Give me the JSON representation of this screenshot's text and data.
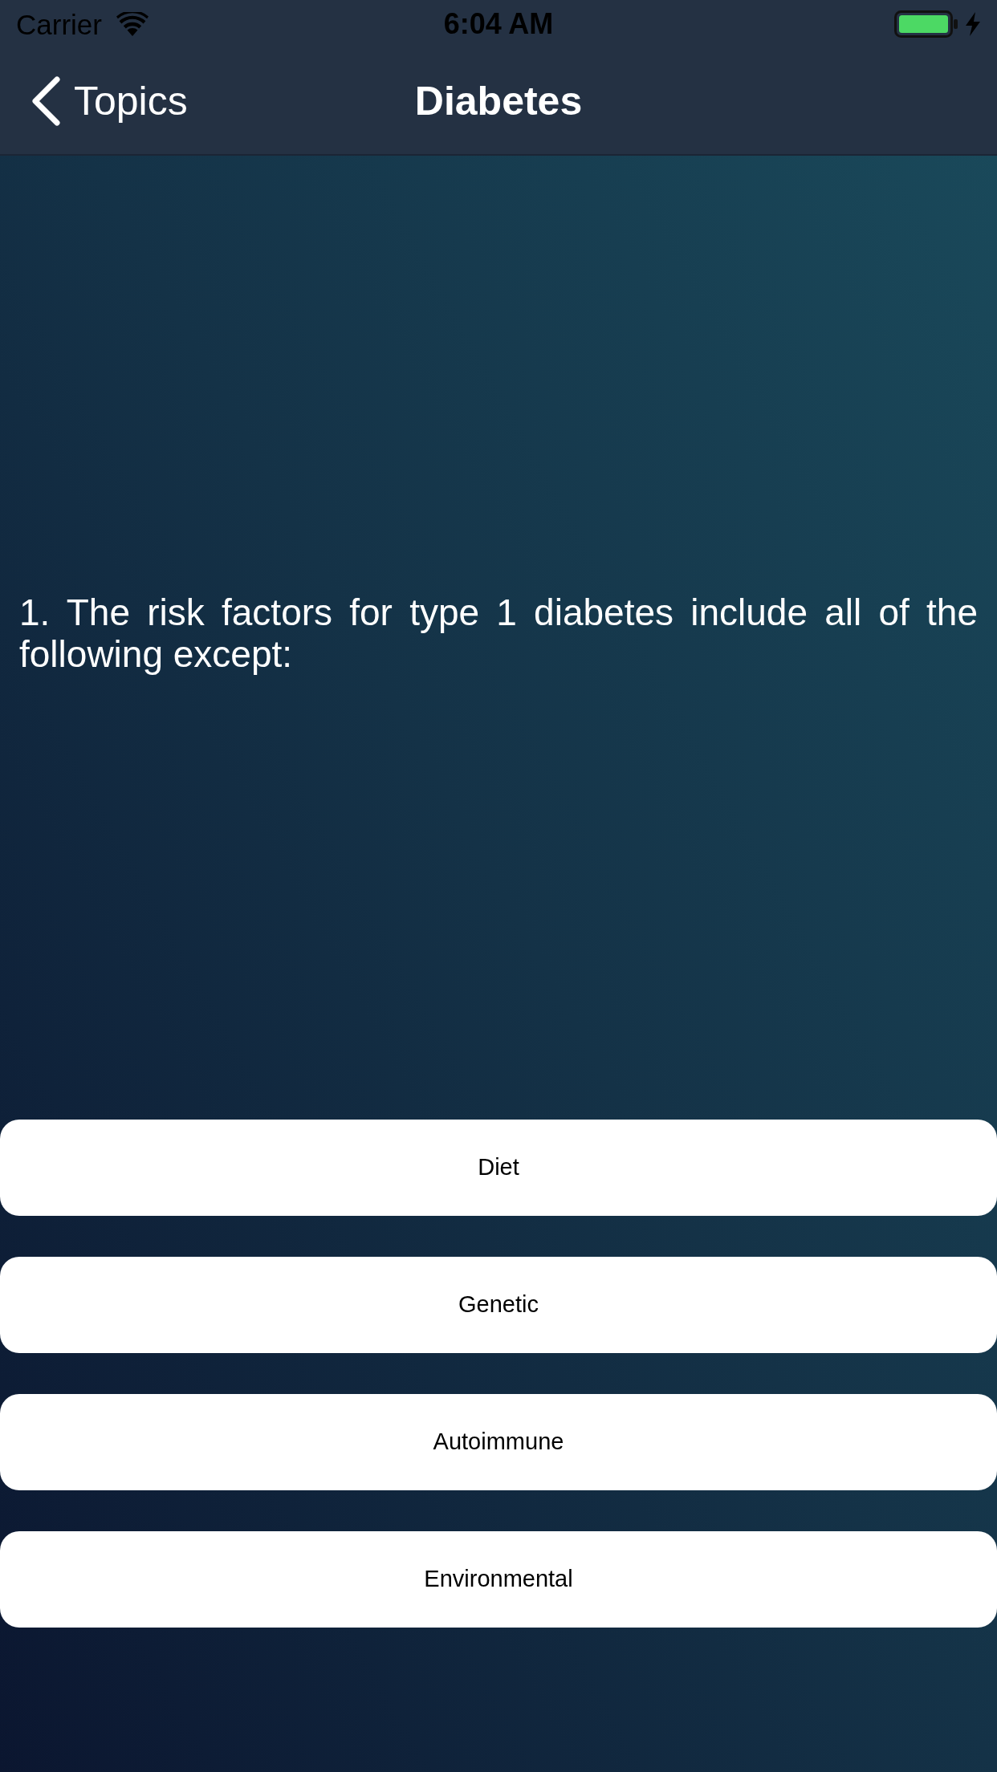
{
  "status_bar": {
    "carrier": "Carrier",
    "time": "6:04 AM",
    "charging": true
  },
  "nav_bar": {
    "back": "Topics",
    "title": "Diabetes"
  },
  "question": {
    "text": "1. The risk factors for type 1 diabetes include all of the following except:"
  },
  "answers": [
    "Diet",
    "Genetic",
    "Autoimmune",
    "Environmental"
  ]
}
